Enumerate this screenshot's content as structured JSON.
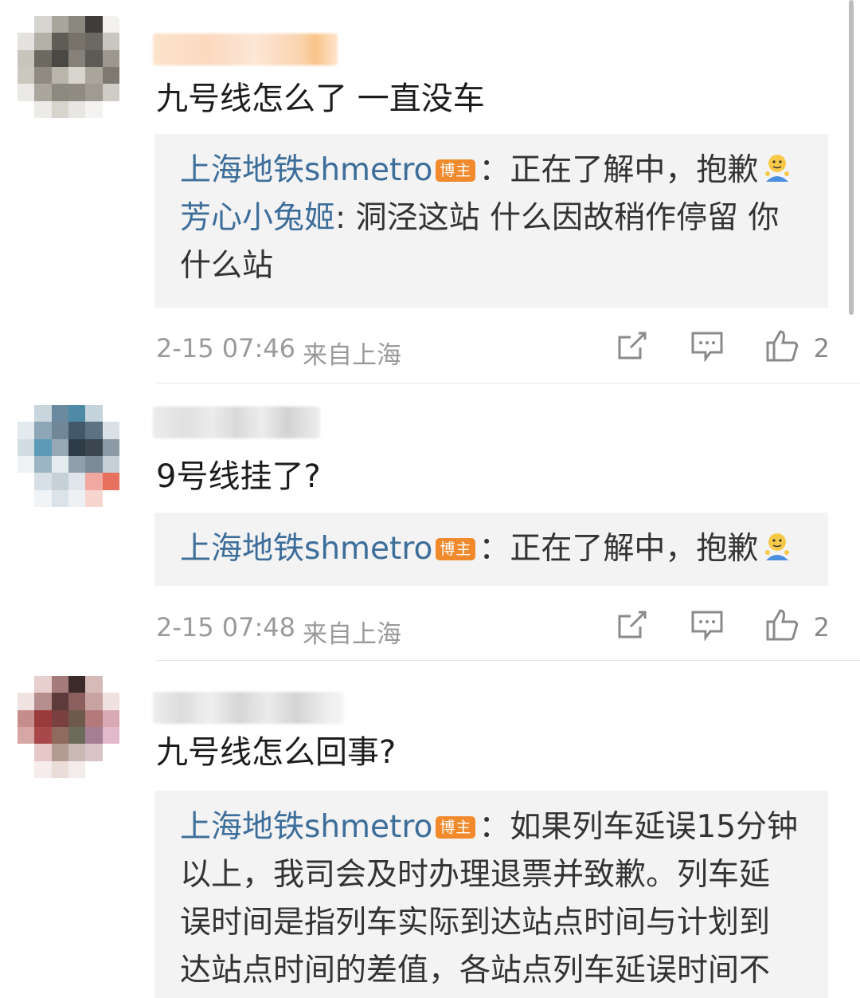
{
  "comments": [
    {
      "text": "九号线怎么了  一直没车",
      "replies": [
        {
          "author": "上海地铁shmetro",
          "badge": "博主",
          "sep": "：",
          "content": "正在了解中，抱歉",
          "emoji": true
        },
        {
          "author": "芳心小兔姬",
          "sep": ": ",
          "content": "洞泾这站  什么因故稍作停留 你",
          "content2": "什么站"
        }
      ],
      "time": "2-15 07:46",
      "location": "来自上海",
      "likes": "2"
    },
    {
      "text": "9号线挂了?",
      "replies": [
        {
          "author": "上海地铁shmetro",
          "badge": "博主",
          "sep": "：",
          "content": "正在了解中，抱歉",
          "emoji": true
        }
      ],
      "time": "2-15 07:48",
      "location": "来自上海",
      "likes": "2"
    },
    {
      "text": "九号线怎么回事?",
      "replies": [
        {
          "author": "上海地铁shmetro",
          "badge": "博主",
          "sep": "：",
          "content": "如果列车延误15分钟",
          "lines": [
            "以上，我司会及时办理退票并致歉。列车延",
            "误时间是指列车实际到达站点时间与计划到",
            "达站点时间的差值，各站点列车延误时间不"
          ]
        }
      ]
    }
  ],
  "colors": {
    "link": "#3d6e9a",
    "badge": "#f08a2c",
    "reply_bg": "#f3f3f3",
    "meta_text": "#9a9a9a"
  },
  "icons": [
    "share-icon",
    "comment-icon",
    "like-icon",
    "emoji-icon"
  ]
}
